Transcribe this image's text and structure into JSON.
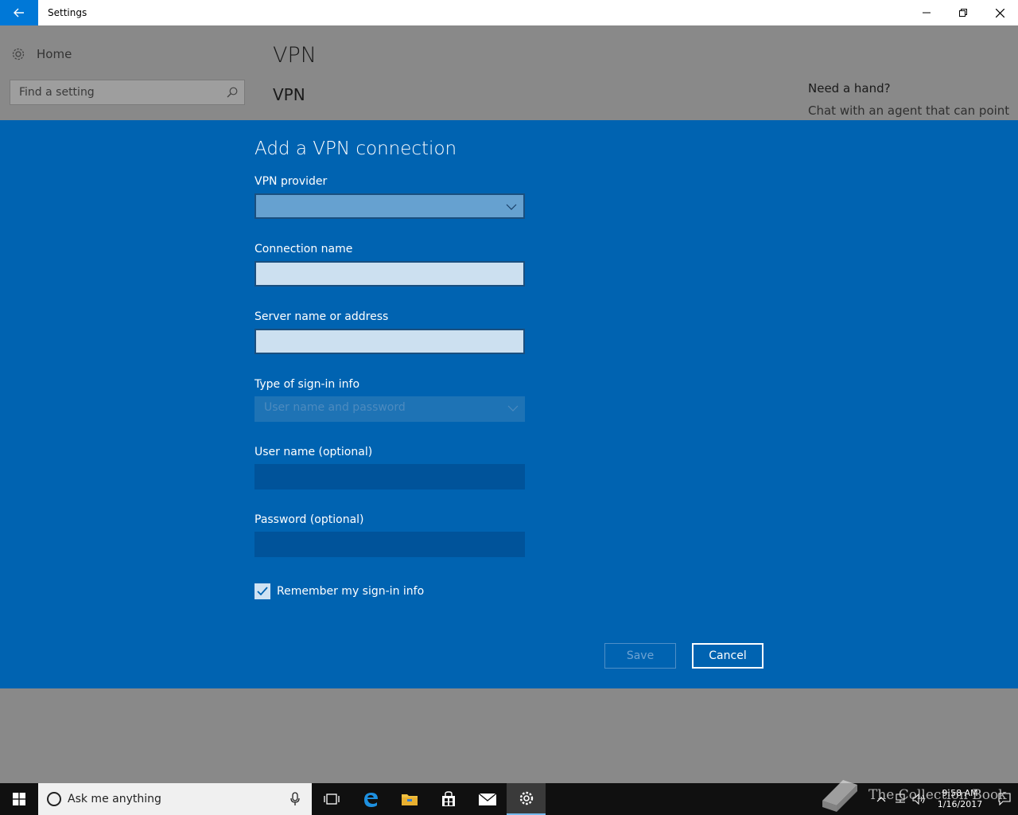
{
  "window": {
    "title": "Settings"
  },
  "settings": {
    "home_label": "Home",
    "search_placeholder": "Find a setting",
    "page_title": "VPN",
    "section_title": "VPN",
    "help_title": "Need a hand?",
    "help_text": "Chat with an agent that can point"
  },
  "dialog": {
    "title": "Add a VPN connection",
    "vpn_provider_label": "VPN provider",
    "vpn_provider_value": "",
    "connection_name_label": "Connection name",
    "connection_name_value": "",
    "server_label": "Server name or address",
    "server_value": "",
    "signin_type_label": "Type of sign-in info",
    "signin_type_value": "User name and password",
    "username_label": "User name (optional)",
    "username_value": "",
    "password_label": "Password (optional)",
    "password_value": "",
    "remember_label": "Remember my sign-in info",
    "remember_checked": true,
    "save_label": "Save",
    "cancel_label": "Cancel"
  },
  "taskbar": {
    "search_text": "Ask me anything",
    "time": "9:58 AM",
    "date": "1/16/2017"
  },
  "watermark": {
    "text": "The Collection Book"
  },
  "colors": {
    "accent": "#0078d7",
    "dialog_bg": "#0063b1",
    "taskbar_bg": "#101010"
  }
}
